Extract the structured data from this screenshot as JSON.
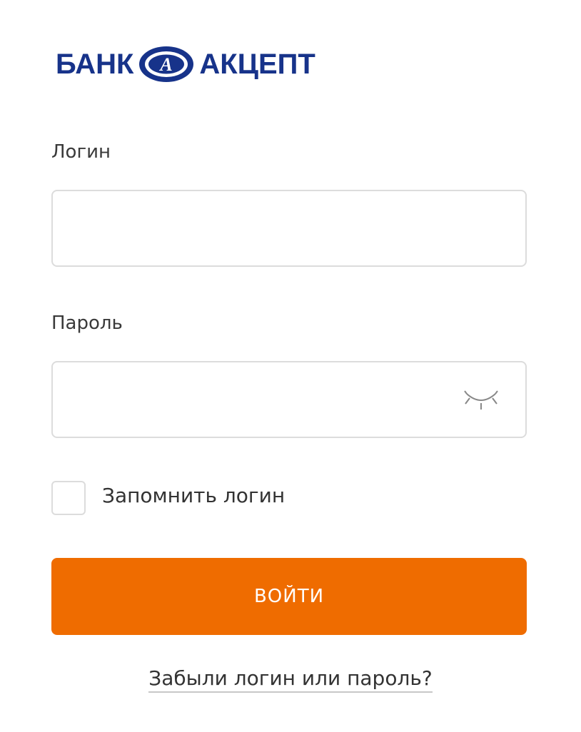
{
  "logo": {
    "word_left": "БАНК",
    "word_right": "АКЦЕПТ",
    "emblem_letter": "А",
    "color": "#17338a"
  },
  "form": {
    "login_label": "Логин",
    "login_value": "",
    "password_label": "Пароль",
    "password_value": "",
    "password_toggle_icon": "eye-closed-icon",
    "remember_label": "Запомнить логин",
    "remember_checked": false,
    "submit_label": "ВОЙТИ",
    "submit_color": "#ef6c00",
    "forgot_link": "Забыли логин или пароль?"
  }
}
